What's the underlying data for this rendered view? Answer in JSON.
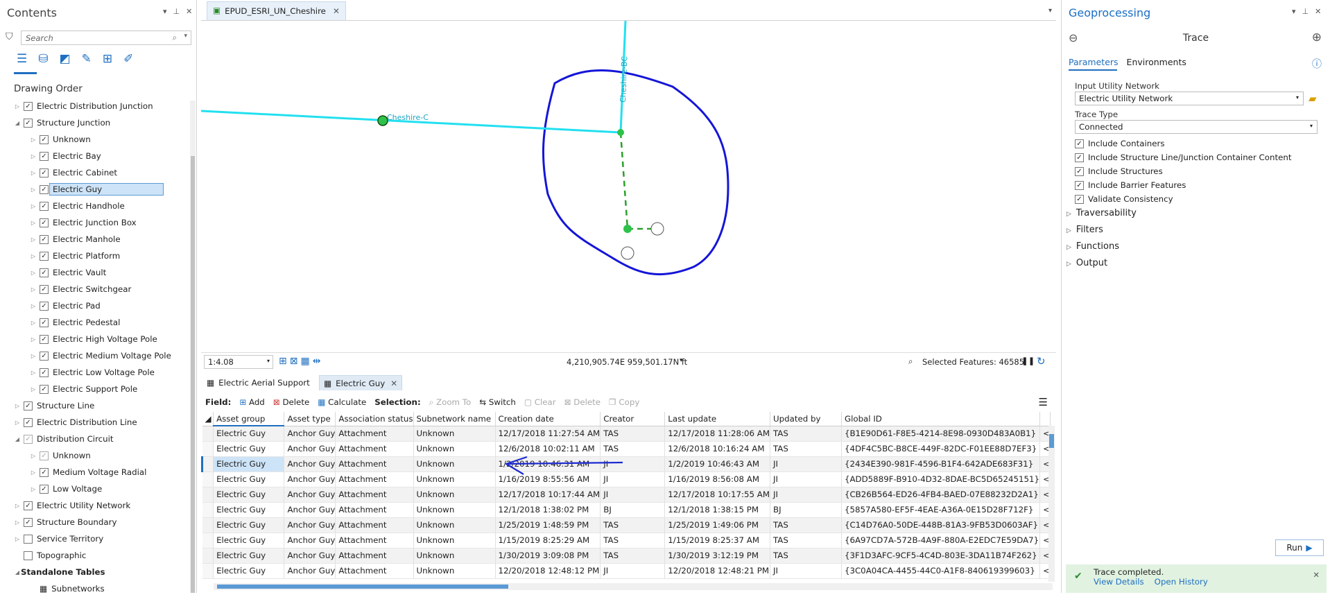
{
  "contents": {
    "title": "Contents",
    "search_placeholder": "Search",
    "section": "Drawing Order",
    "tree": [
      {
        "label": "Electric Distribution Junction",
        "level": 0,
        "exp": "closed",
        "checked": true
      },
      {
        "label": "Structure Junction",
        "level": 0,
        "exp": "open",
        "checked": true
      },
      {
        "label": "Unknown",
        "level": 1,
        "exp": "closed",
        "checked": true
      },
      {
        "label": "Electric Bay",
        "level": 1,
        "exp": "closed",
        "checked": true
      },
      {
        "label": "Electric Cabinet",
        "level": 1,
        "exp": "closed",
        "checked": true
      },
      {
        "label": "Electric Guy",
        "level": 1,
        "exp": "closed",
        "checked": true,
        "selected": true
      },
      {
        "label": "Electric Handhole",
        "level": 1,
        "exp": "closed",
        "checked": true
      },
      {
        "label": "Electric Junction Box",
        "level": 1,
        "exp": "closed",
        "checked": true
      },
      {
        "label": "Electric Manhole",
        "level": 1,
        "exp": "closed",
        "checked": true
      },
      {
        "label": "Electric Platform",
        "level": 1,
        "exp": "closed",
        "checked": true
      },
      {
        "label": "Electric Vault",
        "level": 1,
        "exp": "closed",
        "checked": true
      },
      {
        "label": "Electric Switchgear",
        "level": 1,
        "exp": "closed",
        "checked": true
      },
      {
        "label": "Electric Pad",
        "level": 1,
        "exp": "closed",
        "checked": true
      },
      {
        "label": "Electric Pedestal",
        "level": 1,
        "exp": "closed",
        "checked": true
      },
      {
        "label": "Electric High Voltage Pole",
        "level": 1,
        "exp": "closed",
        "checked": true
      },
      {
        "label": "Electric Medium Voltage Pole",
        "level": 1,
        "exp": "closed",
        "checked": true
      },
      {
        "label": "Electric Low Voltage Pole",
        "level": 1,
        "exp": "closed",
        "checked": true
      },
      {
        "label": "Electric Support Pole",
        "level": 1,
        "exp": "closed",
        "checked": true
      },
      {
        "label": "Structure Line",
        "level": 0,
        "exp": "closed",
        "checked": true
      },
      {
        "label": "Electric Distribution Line",
        "level": 0,
        "exp": "closed",
        "checked": true
      },
      {
        "label": "Distribution Circuit",
        "level": 0,
        "exp": "open",
        "checked": true,
        "dim": true
      },
      {
        "label": "Unknown",
        "level": 1,
        "exp": "closed",
        "checked": true,
        "dim": true
      },
      {
        "label": "Medium Voltage Radial",
        "level": 1,
        "exp": "closed",
        "checked": true
      },
      {
        "label": "Low Voltage",
        "level": 1,
        "exp": "closed",
        "checked": true
      },
      {
        "label": "Electric Utility Network",
        "level": 0,
        "exp": "closed",
        "checked": true
      },
      {
        "label": "Structure Boundary",
        "level": 0,
        "exp": "closed",
        "checked": true
      },
      {
        "label": "Service Territory",
        "level": 0,
        "exp": "closed",
        "checked": false
      },
      {
        "label": "Topographic",
        "level": 0,
        "exp": "none",
        "checked": false
      },
      {
        "label": "Standalone Tables",
        "level": 0,
        "exp": "open",
        "checked": null,
        "header": true
      },
      {
        "label": "Subnetworks",
        "level": 1,
        "exp": "none",
        "checked": null,
        "table": true
      }
    ]
  },
  "map": {
    "tab_label": "EPUD_ESRI_UN_Cheshire",
    "labels": {
      "cheshire_c": "Cheshire-C",
      "cheshire_bc": "Cheshire-BC"
    },
    "scale": "1:4.08",
    "coordinates": "4,210,905.74E 959,501.17N ft",
    "selected_features": "Selected Features: 46585",
    "colors": {
      "line": "#22e0f0",
      "polygon": "#1515d8",
      "dashed": "#2aa02a",
      "junction": "#2ec24a"
    }
  },
  "table": {
    "tabs": [
      "Electric Aerial Support",
      "Electric Guy"
    ],
    "toolbar": {
      "field": "Field:",
      "add": "Add",
      "delete": "Delete",
      "calculate": "Calculate",
      "selection": "Selection:",
      "zoom_to": "Zoom To",
      "switch": "Switch",
      "clear": "Clear",
      "delete2": "Delete",
      "copy": "Copy"
    },
    "columns": [
      "Asset group",
      "Asset type",
      "Association status",
      "Subnetwork name",
      "Creation date",
      "Creator",
      "Last update",
      "Updated by",
      "Global ID"
    ],
    "rows": [
      [
        "Electric Guy",
        "Anchor Guy",
        "Attachment",
        "Unknown",
        "12/17/2018 11:27:54 AM",
        "TAS",
        "12/17/2018 11:28:06 AM",
        "TAS",
        "{B1E90D61-F8E5-4214-8E98-0930D483A0B1}"
      ],
      [
        "Electric Guy",
        "Anchor Guy",
        "Attachment",
        "Unknown",
        "12/6/2018 10:02:11 AM",
        "TAS",
        "12/6/2018 10:16:24 AM",
        "TAS",
        "{4DF4C5BC-B8CE-449F-82DC-F01EE88D7EF3}"
      ],
      [
        "Electric Guy",
        "Anchor Guy",
        "Attachment",
        "Unknown",
        "1/2/2019 10:46:31 AM",
        "JI",
        "1/2/2019 10:46:43 AM",
        "JI",
        "{2434E390-981F-4596-B1F4-642ADE683F31}"
      ],
      [
        "Electric Guy",
        "Anchor Guy",
        "Attachment",
        "Unknown",
        "1/16/2019 8:55:56 AM",
        "JI",
        "1/16/2019 8:56:08 AM",
        "JI",
        "{ADD5889F-B910-4D32-8DAE-BC5D65245151}"
      ],
      [
        "Electric Guy",
        "Anchor Guy",
        "Attachment",
        "Unknown",
        "12/17/2018 10:17:44 AM",
        "JI",
        "12/17/2018 10:17:55 AM",
        "JI",
        "{CB26B564-ED26-4FB4-BAED-07E88232D2A1}"
      ],
      [
        "Electric Guy",
        "Anchor Guy",
        "Attachment",
        "Unknown",
        "12/1/2018 1:38:02 PM",
        "BJ",
        "12/1/2018 1:38:15 PM",
        "BJ",
        "{5857A580-EF5F-4EAE-A36A-0E15D28F712F}"
      ],
      [
        "Electric Guy",
        "Anchor Guy",
        "Attachment",
        "Unknown",
        "1/25/2019 1:48:59 PM",
        "TAS",
        "1/25/2019 1:49:06 PM",
        "TAS",
        "{C14D76A0-50DE-448B-81A3-9FB53D0603AF}"
      ],
      [
        "Electric Guy",
        "Anchor Guy",
        "Attachment",
        "Unknown",
        "1/15/2019 8:25:29 AM",
        "TAS",
        "1/15/2019 8:25:37 AM",
        "TAS",
        "{6A97CD7A-572B-4A9F-880A-E2EDC7E59DA7}"
      ],
      [
        "Electric Guy",
        "Anchor Guy",
        "Attachment",
        "Unknown",
        "1/30/2019 3:09:08 PM",
        "TAS",
        "1/30/2019 3:12:19 PM",
        "TAS",
        "{3F1D3AFC-9CF5-4C4D-803E-3DA11B74F262}"
      ],
      [
        "Electric Guy",
        "Anchor Guy",
        "Attachment",
        "Unknown",
        "12/20/2018 12:48:12 PM",
        "JI",
        "12/20/2018 12:48:21 PM",
        "JI",
        "{3C0A04CA-4455-44C0-A1F8-840619399603}"
      ]
    ],
    "selected_row": 2
  },
  "geo": {
    "title": "Geoprocessing",
    "tool": "Trace",
    "tabs": [
      "Parameters",
      "Environments"
    ],
    "input_label": "Input Utility Network",
    "input_value": "Electric Utility Network",
    "trace_type_label": "Trace Type",
    "trace_type_value": "Connected",
    "checks": [
      "Include Containers",
      "Include Structure Line/Junction Container Content",
      "Include Structures",
      "Include Barrier Features",
      "Validate Consistency"
    ],
    "sections": [
      "Traversability",
      "Filters",
      "Functions",
      "Output"
    ],
    "run": "Run",
    "status": "Trace completed.",
    "view_details": "View Details",
    "open_history": "Open History"
  }
}
